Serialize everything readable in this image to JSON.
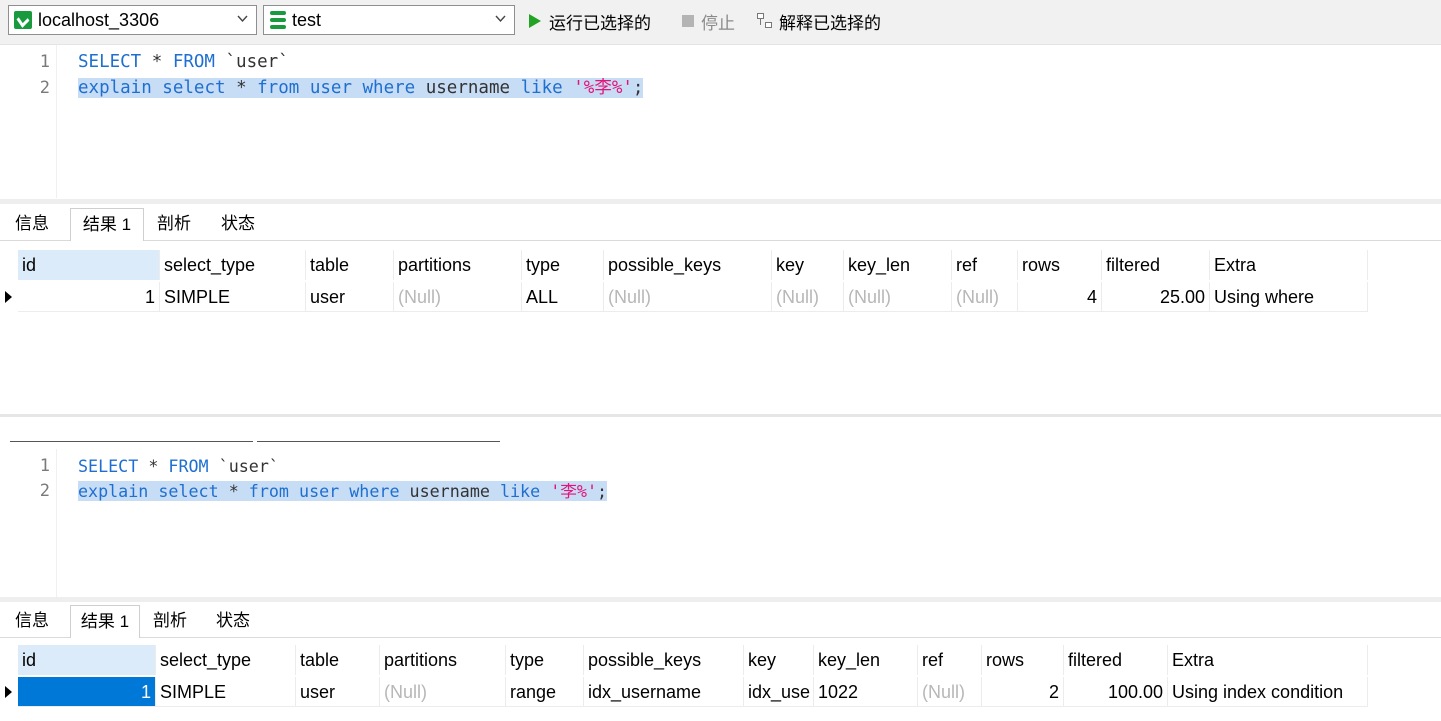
{
  "toolbar": {
    "connection": "localhost_3306",
    "database": "test",
    "run_selected": "运行已选择的",
    "stop": "停止",
    "explain_selected": "解释已选择的",
    "colors": {
      "run": "#22a326",
      "db": "#1a9a3e"
    }
  },
  "panel1": {
    "line_numbers": [
      "1",
      "2"
    ],
    "line1": {
      "kw1": "SELECT",
      "star": " * ",
      "kw2": "FROM",
      "ident": " `user`"
    },
    "line2": {
      "kw1": "explain",
      "kw2": " select",
      "star": " * ",
      "kw3": "from",
      "kw4": " user",
      "kw5": " where",
      "ident": " username",
      "kw6": " like",
      "str": " '%李%'",
      "semi": ";"
    },
    "tabs": [
      "信息",
      "结果 1",
      "剖析",
      "状态"
    ],
    "columns": [
      "id",
      "select_type",
      "table",
      "partitions",
      "type",
      "possible_keys",
      "key",
      "key_len",
      "ref",
      "rows",
      "filtered",
      "Extra"
    ],
    "row": [
      "1",
      "SIMPLE",
      "user",
      "(Null)",
      "ALL",
      "(Null)",
      "(Null)",
      "(Null)",
      "(Null)",
      "4",
      "25.00",
      "Using where"
    ]
  },
  "panel2": {
    "line_numbers": [
      "1",
      "2"
    ],
    "line1": {
      "kw1": "SELECT",
      "star": " * ",
      "kw2": "FROM",
      "ident": " `user`"
    },
    "line2": {
      "kw1": "explain",
      "kw2": " select",
      "star": " * ",
      "kw3": "from",
      "kw4": " user",
      "kw5": " where",
      "ident": " username",
      "kw6": " like",
      "str": " '李%'",
      "semi": ";"
    },
    "tabs": [
      "信息",
      "结果 1",
      "剖析",
      "状态"
    ],
    "columns": [
      "id",
      "select_type",
      "table",
      "partitions",
      "type",
      "possible_keys",
      "key",
      "key_len",
      "ref",
      "rows",
      "filtered",
      "Extra"
    ],
    "row": [
      "1",
      "SIMPLE",
      "user",
      "(Null)",
      "range",
      "idx_username",
      "idx_use",
      "1022",
      "(Null)",
      "2",
      "100.00",
      "Using index condition"
    ]
  }
}
